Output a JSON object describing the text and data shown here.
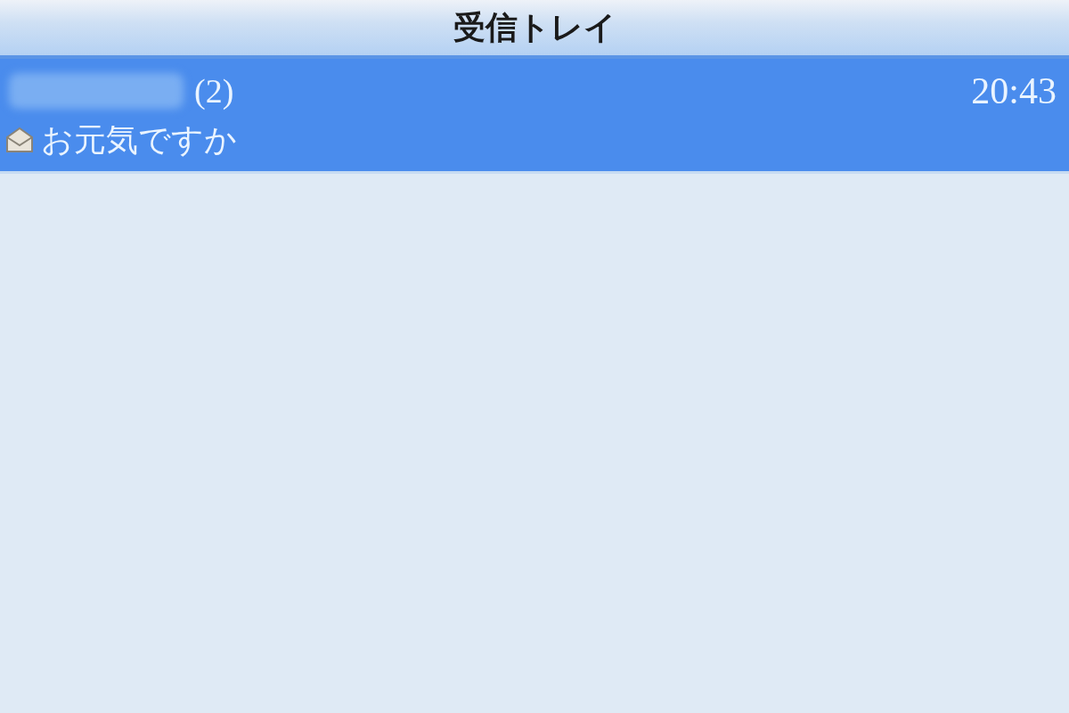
{
  "window": {
    "title": "受信トレイ"
  },
  "messages": [
    {
      "count": "(2)",
      "time": "20:43",
      "subject": "お元気ですか",
      "selected": true,
      "opened": true
    }
  ]
}
